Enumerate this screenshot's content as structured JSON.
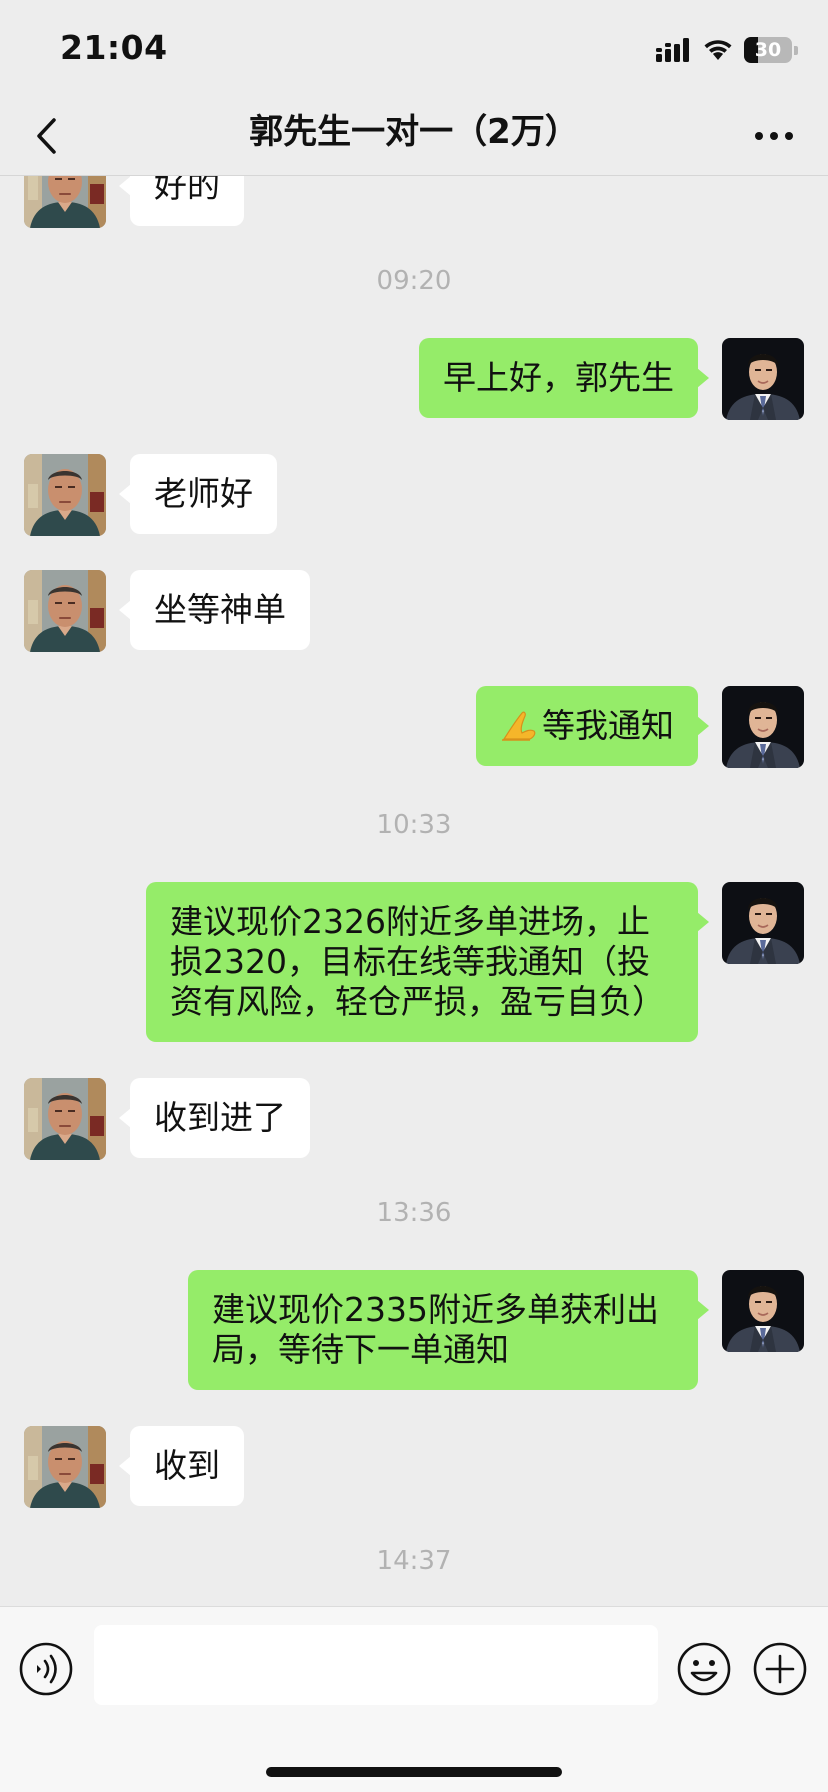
{
  "status_bar": {
    "time": "21:04",
    "battery": "30",
    "battery_level": 0.3
  },
  "header": {
    "title": "郭先生一对一（2万）",
    "back_icon": "chevron-left-icon",
    "more_icon": "ellipsis-icon"
  },
  "messages": [
    {
      "type": "text",
      "side": "left",
      "text": "好的"
    },
    {
      "type": "time",
      "text": "09:20"
    },
    {
      "type": "text",
      "side": "right",
      "text": "早上好，郭先生"
    },
    {
      "type": "text",
      "side": "left",
      "text": "老师好"
    },
    {
      "type": "text",
      "side": "left",
      "text": "坐等神单"
    },
    {
      "type": "text",
      "side": "right",
      "text": "等我通知",
      "emoji": "folded-hands-icon"
    },
    {
      "type": "time",
      "text": "10:33"
    },
    {
      "type": "text",
      "side": "right",
      "text": "建议现价2326附近多单进场，止损2320，目标在线等我通知（投资有风险，轻仓严损，盈亏自负）"
    },
    {
      "type": "text",
      "side": "left",
      "text": "收到进了"
    },
    {
      "type": "time",
      "text": "13:36"
    },
    {
      "type": "text",
      "side": "right",
      "text": "建议现价2335附近多单获利出局，等待下一单通知"
    },
    {
      "type": "text",
      "side": "left",
      "text": "收到"
    },
    {
      "type": "time",
      "text": "14:37"
    }
  ],
  "input_bar": {
    "value": "",
    "voice_icon": "voice-icon",
    "emoji_icon": "smiley-icon",
    "plus_icon": "plus-circle-icon"
  },
  "colors": {
    "background": "#ededed",
    "sent_bubble": "#95ec69",
    "received_bubble": "#ffffff",
    "timestamp": "#b2b2b2"
  }
}
